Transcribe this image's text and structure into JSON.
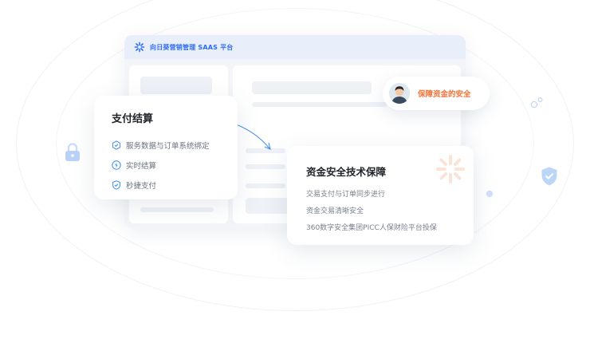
{
  "dashboard": {
    "title": "向日葵营销管理 SAAS 平台"
  },
  "payment_card": {
    "title": "支付结算",
    "items": [
      {
        "icon": "hexagon-shield-icon",
        "label": "服务数据与订单系统绑定"
      },
      {
        "icon": "lightning-icon",
        "label": "实时结算"
      },
      {
        "icon": "shield-check-icon",
        "label": "秒捷支付"
      }
    ]
  },
  "tech_card": {
    "title": "资金安全技术保障",
    "lines": [
      "交易支付与订单同步进行",
      "资金交易清晰安全",
      "360数字安全集团PICC人保财险平台投保"
    ]
  },
  "badge": {
    "label": "保障资金的安全"
  },
  "colors": {
    "brand_blue": "#2d6df6",
    "accent_orange": "#f5743a",
    "text_primary": "#1f2329",
    "text_secondary": "#6b7280"
  }
}
